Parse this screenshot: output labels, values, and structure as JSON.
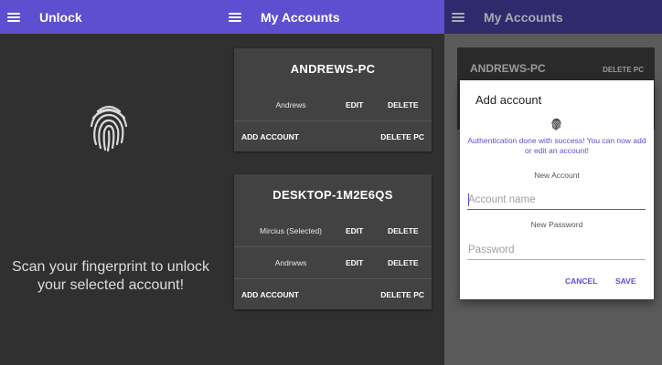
{
  "panel1": {
    "title": "Unlock",
    "message_line1": "Scan your fingerprint to unlock",
    "message_line2": "your selected account!"
  },
  "panel2": {
    "title": "My Accounts",
    "cards": [
      {
        "pc_name": "ANDREWS-PC",
        "accounts": [
          {
            "name": "Andrews",
            "edit": "EDIT",
            "delete": "DELETE"
          }
        ],
        "add_account": "ADD ACCOUNT",
        "delete_pc": "DELETE PC"
      },
      {
        "pc_name": "DESKTOP-1M2E6QS",
        "accounts": [
          {
            "name": "Mircius (Selected)",
            "edit": "EDIT",
            "delete": "DELETE"
          },
          {
            "name": "Andrwws",
            "edit": "EDIT",
            "delete": "DELETE"
          }
        ],
        "add_account": "ADD ACCOUNT",
        "delete_pc": "DELETE PC"
      }
    ]
  },
  "panel3": {
    "title": "My Accounts",
    "background_card": {
      "pc_name": "ANDREWS-PC",
      "delete_pc": "DELETE PC"
    },
    "dialog": {
      "title": "Add account",
      "auth_message": "Authentication done with success! You can now add or edit an account!",
      "new_account_label": "New Account",
      "account_name_placeholder": "Account name",
      "new_password_label": "New Password",
      "password_placeholder": "Password",
      "cancel": "CANCEL",
      "save": "SAVE"
    }
  },
  "colors": {
    "accent": "#5c4fd0",
    "app_bar": "#5c4fd0",
    "background": "#303030",
    "card": "#424242"
  },
  "icons": {
    "menu": "menu-icon",
    "fingerprint": "fingerprint-icon"
  }
}
